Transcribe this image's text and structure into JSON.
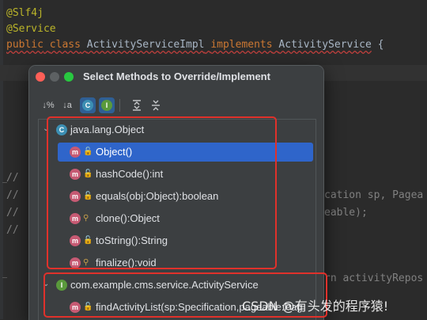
{
  "editor": {
    "lines": {
      "annotation1": "@Slf4j",
      "annotation2": "@Service",
      "kw_public": "public",
      "kw_class": "class",
      "class_name": "ActivityServiceImpl",
      "kw_implements": "implements",
      "interface_name": "ActivityService",
      "brace": "{"
    },
    "comment_marks": [
      "//",
      "//",
      "//",
      "//"
    ],
    "background_fragments": {
      "frag1": "cation sp, Pagea",
      "frag2": "eable);",
      "frag3": "rn activityRepos"
    }
  },
  "dialog": {
    "title": "Select Methods to Override/Implement",
    "toolbar": {
      "sort_visibility_icon": "↓%",
      "sort_alpha_icon": "↓a",
      "show_classes_icon": "C",
      "show_interfaces_icon": "I",
      "expand_all_icon": "expand-all",
      "collapse_all_icon": "collapse-all"
    },
    "tree": {
      "groups": [
        {
          "label": "java.lang.Object",
          "badge": "C",
          "methods": [
            {
              "label": "Object()",
              "selected": true,
              "visibility": "public"
            },
            {
              "label": "hashCode():int",
              "selected": false,
              "visibility": "public"
            },
            {
              "label": "equals(obj:Object):boolean",
              "selected": false,
              "visibility": "public"
            },
            {
              "label": "clone():Object",
              "selected": false,
              "visibility": "protected"
            },
            {
              "label": "toString():String",
              "selected": false,
              "visibility": "public"
            },
            {
              "label": "finalize():void",
              "selected": false,
              "visibility": "protected"
            }
          ]
        },
        {
          "label": "com.example.cms.service.ActivityService",
          "badge": "I",
          "methods": [
            {
              "label": "findActivityList(sp:Specification,pageable:Pag",
              "selected": false,
              "visibility": "public"
            }
          ]
        }
      ]
    }
  },
  "watermark": "CSDN @有头发的程序猿!",
  "colors": {
    "selection": "#2f65ca",
    "highlight_box": "#e0312b",
    "class_badge": "#3c8fb3",
    "interface_badge": "#5a9a3c",
    "method_badge": "#c65a73"
  }
}
